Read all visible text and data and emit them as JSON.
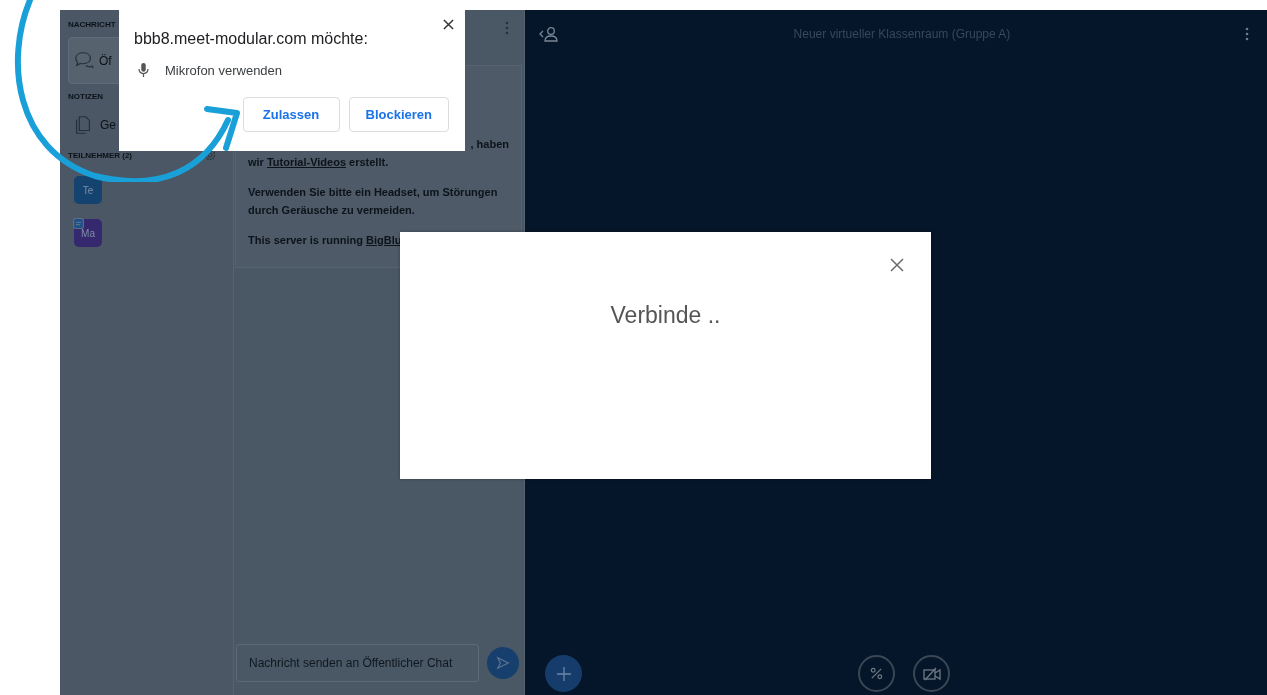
{
  "browser_prompt": {
    "origin_text": "bbb8.meet-modular.com möchte:",
    "permission": "Mikrofon verwenden",
    "buttons": [
      {
        "label": "Zulassen"
      },
      {
        "label": "Blockieren"
      }
    ]
  },
  "sidebar": {
    "messages_heading": "NACHRICHT",
    "chat_item": "Öf",
    "notes_heading": "NOTIZEN",
    "notes_item": "Ge",
    "participants_heading": "TEILNEHMER (2)",
    "participants": [
      {
        "initials": "Te",
        "color": "#15436f",
        "kind": "plain"
      },
      {
        "initials": "Ma",
        "color": "#35286f",
        "kind": "badge"
      }
    ]
  },
  "chat": {
    "welcome_fragment": ", haben",
    "tutorial_prefix": "wir ",
    "tutorial_link": "Tutorial-Videos",
    "tutorial_suffix": " erstellt.",
    "headset_note": "Verwenden Sie bitte ein Headset, um Störungen durch Geräusche zu vermeiden.",
    "server_prefix": "This server is running ",
    "server_link": "BigBlu",
    "input": {
      "placeholder": "Nachricht senden an Öffentlicher Chat"
    }
  },
  "main": {
    "title": "Neuer virtueller Klassenraum (Gruppe A)"
  },
  "dialog": {
    "message": "Verbinde .."
  }
}
